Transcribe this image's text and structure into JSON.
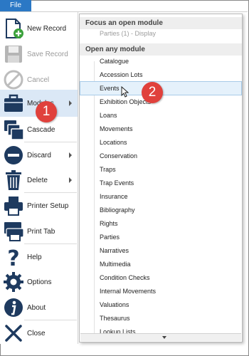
{
  "file_tab": "File",
  "menu": [
    {
      "id": "new-record",
      "label": "New Record",
      "icon": "new-record-icon",
      "enabled": true
    },
    {
      "id": "save-record",
      "label": "Save Record",
      "icon": "save-icon",
      "enabled": false
    },
    {
      "id": "cancel",
      "label": "Cancel",
      "icon": "cancel-icon",
      "enabled": false
    },
    {
      "id": "modules",
      "label": "Modules",
      "icon": "briefcase-icon",
      "enabled": true,
      "submenu": true
    },
    {
      "id": "cascade",
      "label": "Cascade",
      "icon": "cascade-icon",
      "enabled": true
    },
    {
      "id": "discard",
      "label": "Discard",
      "icon": "discard-icon",
      "enabled": true,
      "submenu": true
    },
    {
      "id": "delete",
      "label": "Delete",
      "icon": "trash-icon",
      "enabled": true,
      "submenu": true
    },
    {
      "id": "printer-setup",
      "label": "Printer Setup",
      "icon": "printer-icon",
      "enabled": true
    },
    {
      "id": "print-tab",
      "label": "Print Tab",
      "icon": "print-tab-icon",
      "enabled": true
    },
    {
      "id": "help",
      "label": "Help",
      "icon": "help-icon",
      "enabled": true
    },
    {
      "id": "options",
      "label": "Options",
      "icon": "gear-icon",
      "enabled": true
    },
    {
      "id": "about",
      "label": "About",
      "icon": "info-icon",
      "enabled": true
    },
    {
      "id": "close",
      "label": "Close",
      "icon": "close-icon",
      "enabled": true
    }
  ],
  "submenu": {
    "focus_heading": "Focus an open module",
    "focus_item": "Parties (1) - Display",
    "open_heading": "Open any module",
    "modules": [
      "Catalogue",
      "Accession Lots",
      "Events",
      "Exhibition Objects",
      "Loans",
      "Movements",
      "Locations",
      "Conservation",
      "Traps",
      "Trap Events",
      "Insurance",
      "Bibliography",
      "Rights",
      "Parties",
      "Narratives",
      "Multimedia",
      "Condition Checks",
      "Internal Movements",
      "Valuations",
      "Thesaurus",
      "Lookup Lists"
    ],
    "highlighted": "Events"
  },
  "badges": [
    "1",
    "2"
  ],
  "colors": {
    "accent": "#2b78c5",
    "badge": "#e0413c",
    "hover": "#dbe8f6"
  }
}
